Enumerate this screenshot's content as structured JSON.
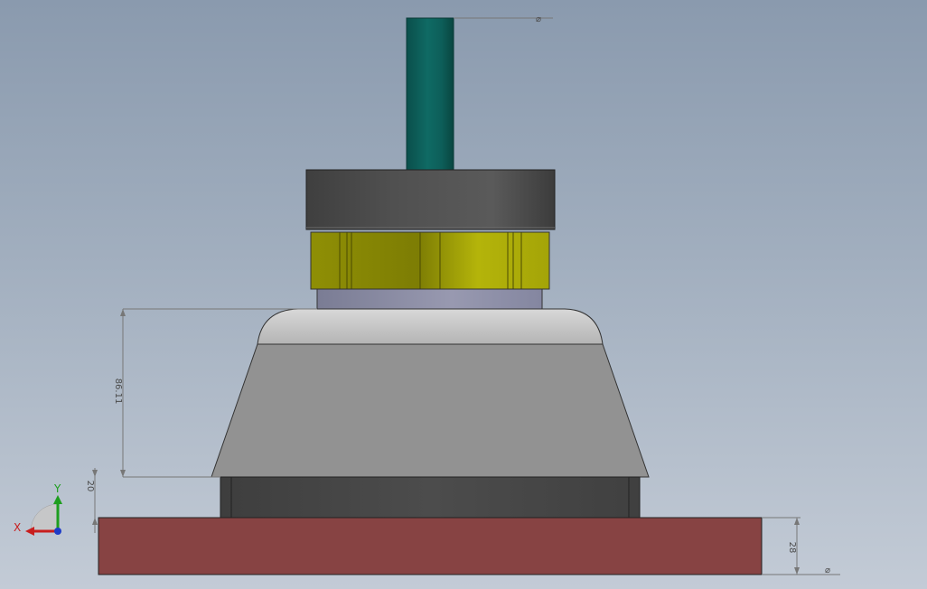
{
  "viewport": {
    "background_top": "#8a9aae",
    "background_bottom": "#c3cbd6"
  },
  "model": {
    "parts": [
      {
        "name": "shaft",
        "color": "#0e5f5a"
      },
      {
        "name": "top-cap",
        "color": "#4b4b4b"
      },
      {
        "name": "yellow-ring",
        "color": "#a6a607"
      },
      {
        "name": "lavender-band",
        "color": "#8d8fa6"
      },
      {
        "name": "gray-hood",
        "color": "#929292"
      },
      {
        "name": "dark-base-block",
        "color": "#474747"
      },
      {
        "name": "base-plate",
        "color": "#874343"
      }
    ]
  },
  "dimensions": {
    "height_dim": "86.11",
    "gap_dim": "20",
    "plate_dim": "28",
    "diameter_symbol": "⌀"
  },
  "triad": {
    "x_label": "X",
    "y_label": "Y",
    "x_color": "#c81e1e",
    "y_color": "#1e9e1e",
    "z_color": "#1e3cc8"
  }
}
